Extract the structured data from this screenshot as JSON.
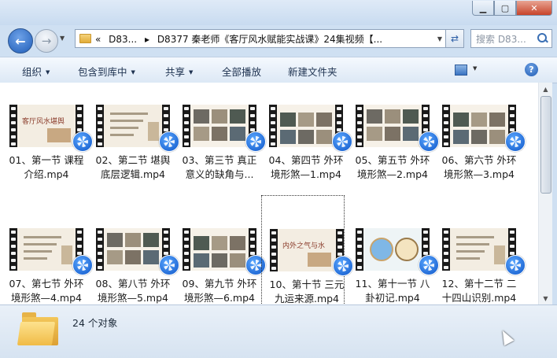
{
  "window": {
    "minimize": "0",
    "maximize": "1",
    "close": "r"
  },
  "nav": {
    "back_icon": "arrow-left",
    "forward_icon": "arrow-right"
  },
  "address": {
    "overflow": "«",
    "parts": [
      "D83...",
      "D8377 秦老师《客厅风水赋能实战课》24集视频【..."
    ]
  },
  "search": {
    "placeholder": "搜索 D83..."
  },
  "toolbar": {
    "organize": "组织",
    "include_library": "包含到库中",
    "share": "共享",
    "play_all": "全部播放",
    "new_folder": "新建文件夹"
  },
  "files": [
    {
      "line1": "01、第一节 课程",
      "line2": "介绍.mp4",
      "frame": "title",
      "frame_title": "客厅风水堪舆"
    },
    {
      "line1": "02、第二节 堪舆",
      "line2": "底层逻辑.mp4",
      "frame": "text"
    },
    {
      "line1": "03、第三节 真正",
      "line2": "意义的缺角与...",
      "frame": "photos"
    },
    {
      "line1": "04、第四节 外环",
      "line2": "境形煞—1.mp4",
      "frame": "photos2"
    },
    {
      "line1": "05、第五节 外环",
      "line2": "境形煞—2.mp4",
      "frame": "photos"
    },
    {
      "line1": "06、第六节 外环",
      "line2": "境形煞—3.mp4",
      "frame": "photos2"
    },
    {
      "line1": "07、第七节 外环",
      "line2": "境形煞—4.mp4",
      "frame": "text"
    },
    {
      "line1": "08、第八节 外环",
      "line2": "境形煞—5.mp4",
      "frame": "photos"
    },
    {
      "line1": "09、第九节 外环",
      "line2": "境形煞—6.mp4",
      "frame": "photos2"
    },
    {
      "line1": "10、第十节 三元",
      "line2": "九运来源.mp4",
      "frame": "title",
      "frame_title": "内外之气与水"
    },
    {
      "line1": "11、第十一节 八",
      "line2": "卦初记.mp4",
      "frame": "bagua"
    },
    {
      "line1": "12、第十二节 二",
      "line2": "十四山识别.mp4",
      "frame": "text"
    }
  ],
  "status": {
    "count": "24 个对象"
  },
  "colors": {
    "accent": "#2a6fd0",
    "film": "#1a1a1a",
    "slide_bg": "#f3ede2"
  }
}
